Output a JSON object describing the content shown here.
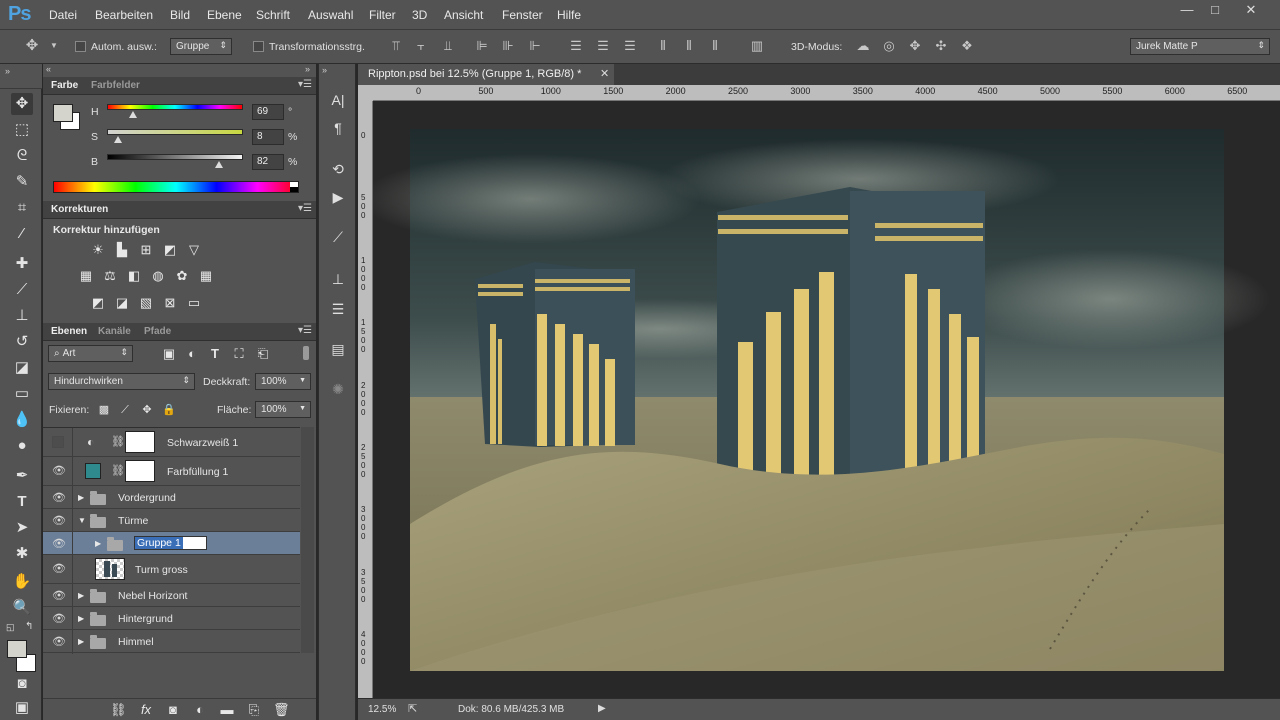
{
  "app": {
    "logo": "Ps",
    "accent": "#4fa3e0"
  },
  "menu": [
    "Datei",
    "Bearbeiten",
    "Bild",
    "Ebene",
    "Schrift",
    "Auswahl",
    "Filter",
    "3D",
    "Ansicht",
    "Fenster",
    "Hilfe"
  ],
  "window_controls": {
    "minimize": "—",
    "maximize": "□",
    "close": "✕"
  },
  "options": {
    "auto_select_label": "Autom. ausw.:",
    "auto_select_value": "Gruppe",
    "transform_label": "Transformationsstrg.",
    "mode3d_label": "3D-Modus:",
    "workspace": "Jurek Matte P"
  },
  "color_panel": {
    "tabs": [
      "Farbe",
      "Farbfelder"
    ],
    "h_label": "H",
    "h_value": "69",
    "h_unit": "°",
    "s_label": "S",
    "s_value": "8",
    "s_unit": "%",
    "b_label": "B",
    "b_value": "82",
    "b_unit": "%",
    "h_level": 0.19,
    "s_level": 0.08,
    "b_level": 0.82
  },
  "adjustments": {
    "tab": "Korrekturen",
    "heading": "Korrektur hinzufügen"
  },
  "layers_panel": {
    "tabs": [
      "Ebenen",
      "Kanäle",
      "Pfade"
    ],
    "filter_kind": "Art",
    "blend_mode": "Hindurchwirken",
    "opacity_label": "Deckkraft:",
    "opacity": "100%",
    "lock_label": "Fixieren:",
    "fill_label": "Fläche:",
    "fill": "100%",
    "layers": [
      "Schwarzweiß 1",
      "Farbfüllung 1",
      "Vordergrund",
      "Türme",
      "Gruppe 1",
      "Turm gross",
      "Nebel Horizont",
      "Hintergrund",
      "Himmel"
    ],
    "fill_color": "#2e8a8c"
  },
  "document": {
    "tab_title": "Rippton.psd bei 12.5% (Gruppe 1, RGB/8) *",
    "close": "✕",
    "ruler_h": [
      "0",
      "500",
      "1000",
      "1500",
      "2000",
      "2500",
      "3000",
      "3500",
      "4000",
      "4500",
      "5000",
      "5500",
      "6000",
      "6500"
    ],
    "ruler_v": [
      "0",
      "500",
      "1000",
      "1500",
      "2000",
      "2500",
      "3000",
      "3500",
      "4000"
    ]
  },
  "status": {
    "zoom": "12.5%",
    "doc": "Dok: 80.6 MB/425.3 MB"
  }
}
